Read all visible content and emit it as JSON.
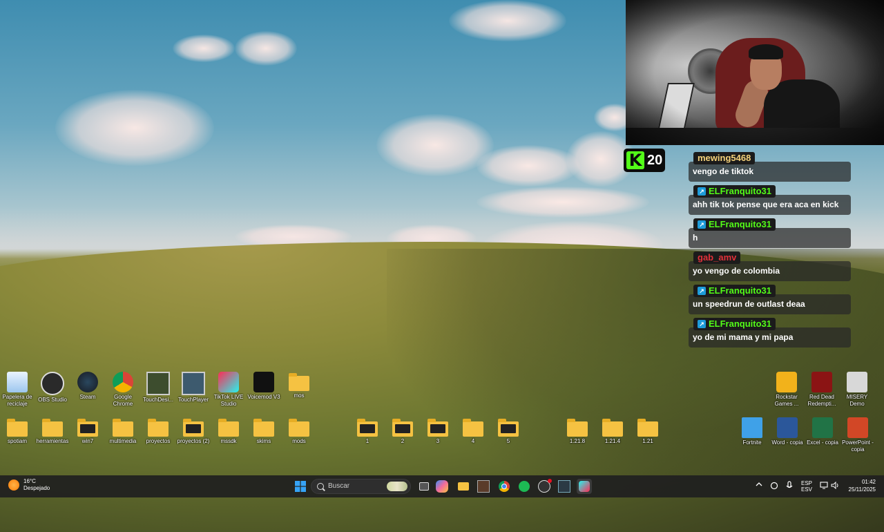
{
  "webcam": {
    "label": ""
  },
  "kick": {
    "count": "20"
  },
  "chat": {
    "messages": [
      {
        "user": "mewing5468",
        "user_color": "#f5d27a",
        "badge": false,
        "text": "vengo de tiktok"
      },
      {
        "user": "ELFranquito31",
        "user_color": "#53fc18",
        "badge": true,
        "text": "ahh tik tok pense que era aca en kick"
      },
      {
        "user": "ELFranquito31",
        "user_color": "#53fc18",
        "badge": true,
        "text": "h"
      },
      {
        "user": "gab_amv",
        "user_color": "#e2313a",
        "badge": false,
        "text": "yo vengo de colombia"
      },
      {
        "user": "ELFranquito31",
        "user_color": "#53fc18",
        "badge": true,
        "text": "un speedrun de outlast deaa"
      },
      {
        "user": "ELFranquito31",
        "user_color": "#53fc18",
        "badge": true,
        "text": "yo de mi mama y mi papa"
      }
    ]
  },
  "desktop": {
    "row1_left": [
      {
        "label": "Papelera de reciclaje",
        "icon": "recycle-bin-icon"
      },
      {
        "label": "OBS Studio",
        "icon": "obs-icon"
      },
      {
        "label": "Steam",
        "icon": "steam-icon"
      },
      {
        "label": "Google Chrome",
        "icon": "chrome-icon"
      },
      {
        "label": "TouchDesi...",
        "icon": "touchdesigner-icon"
      },
      {
        "label": "TouchPlayer",
        "icon": "touchplayer-icon"
      },
      {
        "label": "TikTok LIVE Studio",
        "icon": "tiktok-icon"
      },
      {
        "label": "Voicemod V3",
        "icon": "voicemod-icon"
      },
      {
        "label": "mos",
        "icon": "folder-icon"
      }
    ],
    "row2_left": [
      {
        "label": "spotiam"
      },
      {
        "label": "herramientas"
      },
      {
        "label": "win7"
      },
      {
        "label": "multimedia"
      },
      {
        "label": "proyectos"
      },
      {
        "label": "proyectos (2)"
      },
      {
        "label": "mssdk"
      },
      {
        "label": "skims"
      },
      {
        "label": "mods"
      }
    ],
    "row2_mid": [
      {
        "label": "1"
      },
      {
        "label": "2"
      },
      {
        "label": "3"
      },
      {
        "label": "4"
      },
      {
        "label": "5"
      }
    ],
    "row2_versions": [
      {
        "label": "1.21.8"
      },
      {
        "label": "1.21.4"
      },
      {
        "label": "1.21"
      }
    ],
    "row1_right": [
      {
        "label": "Rockstar Games ...",
        "icon": "rockstar-icon"
      },
      {
        "label": "Red Dead Redempti...",
        "icon": "rdr-icon"
      },
      {
        "label": "MISERY Demo",
        "icon": "misery-icon"
      }
    ],
    "row2_right": [
      {
        "label": "Fortnite",
        "icon": "fortnite-icon"
      },
      {
        "label": "Word - copia",
        "icon": "word-icon"
      },
      {
        "label": "Excel - copia",
        "icon": "excel-icon"
      },
      {
        "label": "PowerPoint - copia",
        "icon": "powerpoint-icon"
      }
    ]
  },
  "taskbar": {
    "weather_temp": "16°C",
    "weather_desc": "Despejado",
    "search_placeholder": "Buscar",
    "lang_top": "ESP",
    "lang_bottom": "ESV",
    "time": "01:42",
    "date": "25/11/2025"
  }
}
